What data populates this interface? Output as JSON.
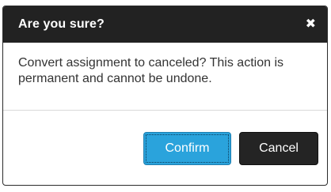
{
  "dialog": {
    "title": "Are you sure?",
    "close_symbol": "✖",
    "message": "Convert assignment to canceled? This action is permanent and cannot be undone.",
    "buttons": {
      "confirm_label": "Confirm",
      "cancel_label": "Cancel"
    }
  },
  "colors": {
    "header_bg": "#222222",
    "confirm_bg": "#2aa3dc",
    "cancel_bg": "#242424"
  }
}
